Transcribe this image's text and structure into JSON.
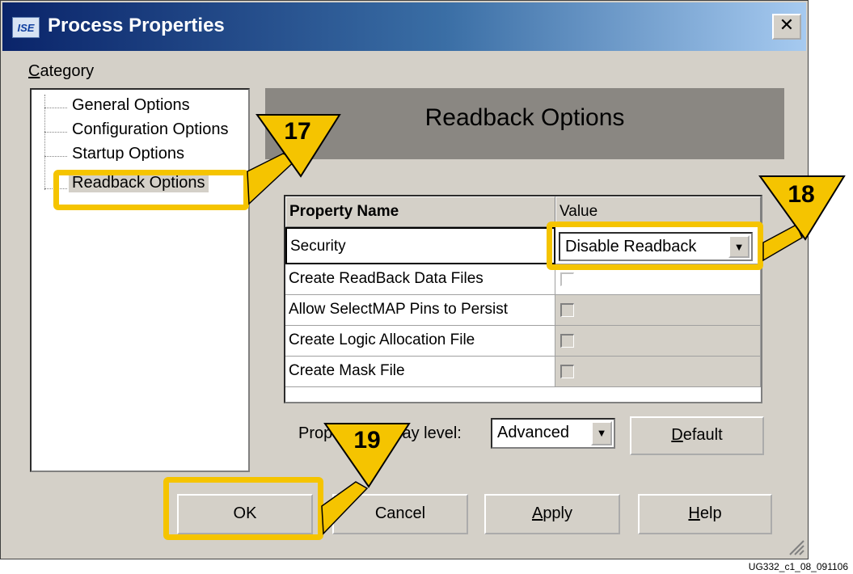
{
  "window": {
    "title": "Process Properties",
    "app_icon": "ISE",
    "close": "✕"
  },
  "category_label": "Category",
  "tree": {
    "items": [
      "General Options",
      "Configuration Options",
      "Startup Options",
      "Readback Options"
    ],
    "selected": "Readback Options"
  },
  "panel": {
    "title": "Readback Options"
  },
  "grid": {
    "headers": [
      "Property Name",
      "Value"
    ],
    "rows": [
      {
        "name": "Security",
        "value": "Disable Readback"
      },
      {
        "name": "Create ReadBack Data Files",
        "value": ""
      },
      {
        "name": "Allow SelectMAP Pins to Persist",
        "value": ""
      },
      {
        "name": "Create Logic Allocation File",
        "value": ""
      },
      {
        "name": "Create Mask File",
        "value": ""
      }
    ]
  },
  "display": {
    "label": "Property display level:",
    "label_visible_left": "Prop",
    "label_visible_right": "lay level:",
    "value": "Advanced",
    "default_button": "Default"
  },
  "buttons": {
    "ok": "OK",
    "cancel": "Cancel",
    "apply": "Apply",
    "help": "Help"
  },
  "callouts": [
    "17",
    "18",
    "19"
  ],
  "caption": "UG332_c1_08_091106",
  "colors": {
    "highlight": "#f5c400",
    "titlebar_start": "#0a246a",
    "panel": "#8a8782"
  }
}
